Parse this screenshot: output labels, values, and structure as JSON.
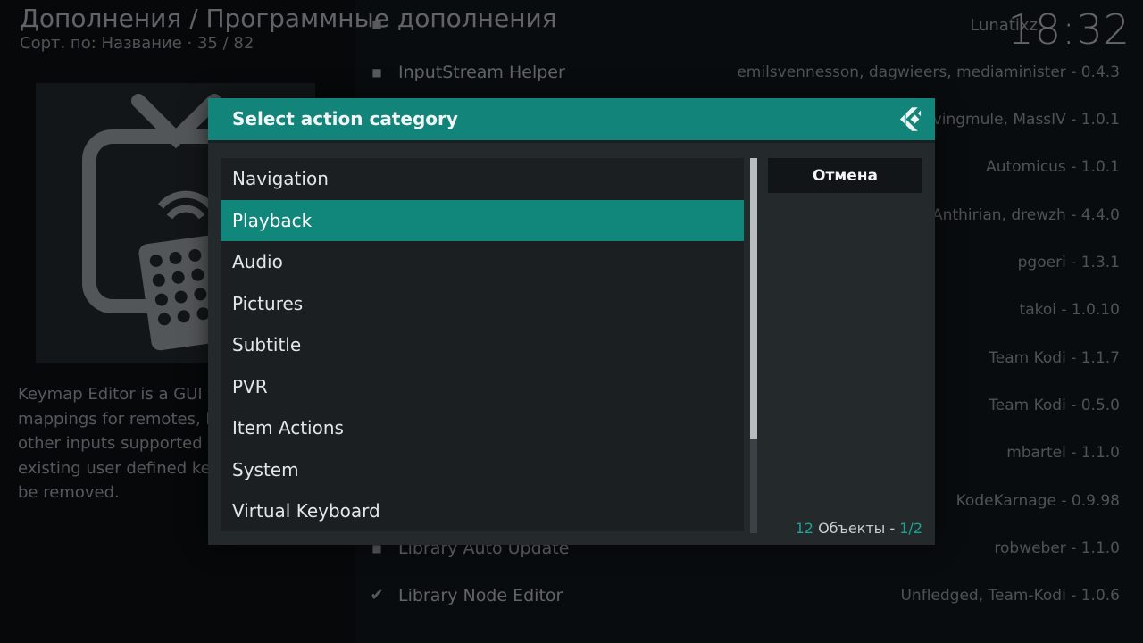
{
  "header": {
    "title": "Дополнения / Программные дополнения",
    "subtitle": "Сорт. по: Название  ·  35 / 82",
    "clock": "18:32",
    "right_text": "Lunatixz"
  },
  "addon": {
    "description": "Keymap Editor is a GUI f... mappings for remotes, k... other inputs supported b... existing user defined key... be removed.",
    "description_lines": [
      "Keymap Editor is a GUI f",
      "mappings for remotes, k",
      "other inputs supported b",
      "existing user defined key",
      "be removed."
    ],
    "icon": "keymap-editor-remote-icon"
  },
  "background_list": [
    {
      "name": "",
      "meta": ""
    },
    {
      "name": "InputStream Helper",
      "meta": "emilsvennesson, dagwieers, mediaminister - 0.4.3"
    },
    {
      "name": "",
      "meta": "divingmule, MassIV - 1.0.1"
    },
    {
      "name": "",
      "meta": "Automicus - 1.0.1"
    },
    {
      "name": "",
      "meta": "Anthirian, drewzh - 4.4.0"
    },
    {
      "name": "",
      "meta": "pgoeri - 1.3.1"
    },
    {
      "name": "",
      "meta": "takoi - 1.0.10"
    },
    {
      "name": "",
      "meta": "Team Kodi - 1.1.7"
    },
    {
      "name": "",
      "meta": "Team Kodi - 0.5.0"
    },
    {
      "name": "",
      "meta": "mbartel - 1.1.0"
    },
    {
      "name": "",
      "meta": "KodeKarnage - 0.9.98"
    },
    {
      "name": "Library Auto Update",
      "meta": "robweber - 1.1.0"
    },
    {
      "name": "Library Node Editor",
      "meta": "Unfledged, Team-Kodi - 1.0.6"
    }
  ],
  "dialog": {
    "title": "Select action category",
    "cancel_label": "Отмена",
    "items": [
      "Navigation",
      "Playback",
      "Audio",
      "Pictures",
      "Subtitle",
      "PVR",
      "Item Actions",
      "System",
      "Virtual Keyboard"
    ],
    "selected_index": 1,
    "counter": {
      "count": "12",
      "label": " Объекты - ",
      "page": "1/2"
    },
    "scroll_fraction_visible": 0.75,
    "accent_color": "#12847a"
  }
}
